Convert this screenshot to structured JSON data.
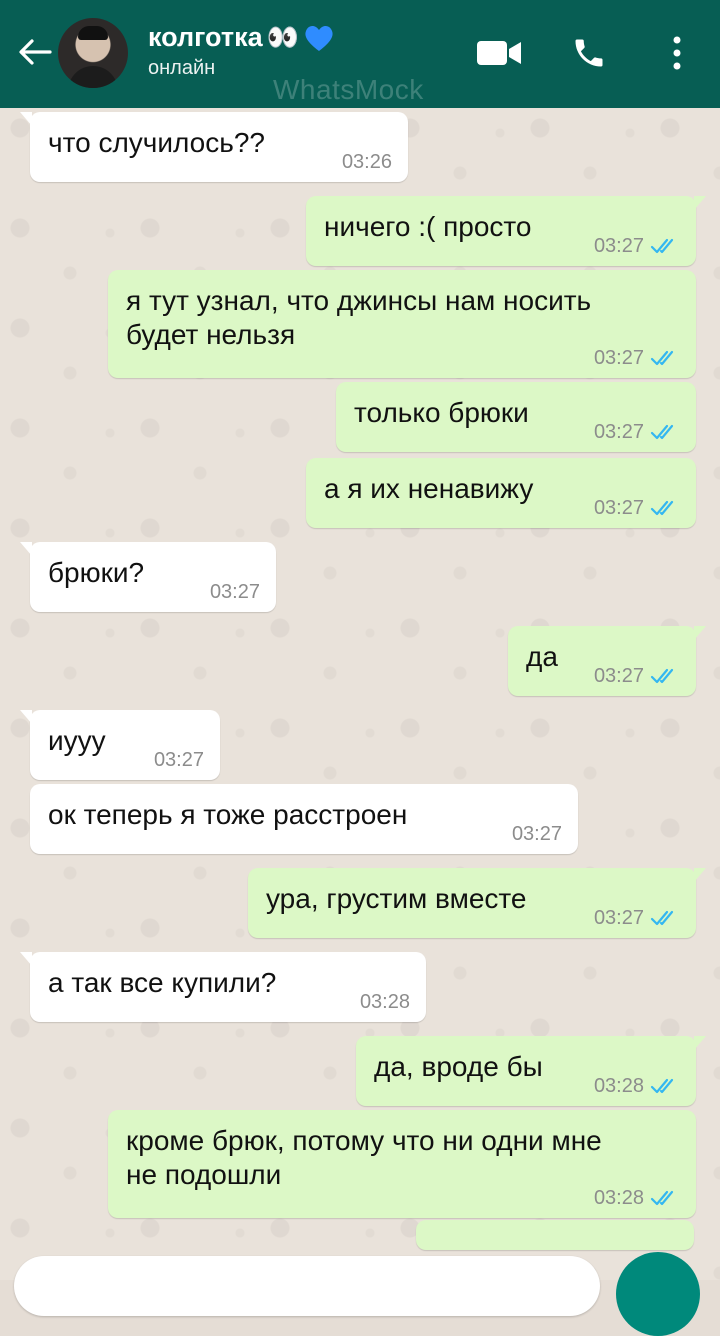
{
  "header": {
    "contact_name": "колготка",
    "emoji": "👀",
    "status": "онлайн",
    "watermark": "WhatsMock"
  },
  "colors": {
    "header": "#075e54",
    "incoming": "#ffffff",
    "outgoing": "#dcf8c6",
    "read_ticks": "#34b7f1",
    "accent": "#00897b"
  },
  "messages": [
    {
      "dir": "in",
      "text": "что случилось??",
      "time": "03:26"
    },
    {
      "dir": "out",
      "text": "ничего :( просто",
      "time": "03:27"
    },
    {
      "dir": "out",
      "text": "я тут узнал, что джинсы нам носить\nбудет нельзя",
      "time": "03:27"
    },
    {
      "dir": "out",
      "text": "только брюки",
      "time": "03:27"
    },
    {
      "dir": "out",
      "text": "а я их ненавижу",
      "time": "03:27"
    },
    {
      "dir": "in",
      "text": "брюки?",
      "time": "03:27"
    },
    {
      "dir": "out",
      "text": "да",
      "time": "03:27"
    },
    {
      "dir": "in",
      "text": "иууу",
      "time": "03:27"
    },
    {
      "dir": "in",
      "text": "ок теперь я тоже расстроен",
      "time": "03:27"
    },
    {
      "dir": "out",
      "text": "ура, грустим вместе",
      "time": "03:27"
    },
    {
      "dir": "in",
      "text": "а так все купили?",
      "time": "03:28"
    },
    {
      "dir": "out",
      "text": "да, вроде бы",
      "time": "03:28"
    },
    {
      "dir": "out",
      "text": "кроме брюк, потому что ни одни мне\nне подошли",
      "time": "03:28"
    }
  ]
}
